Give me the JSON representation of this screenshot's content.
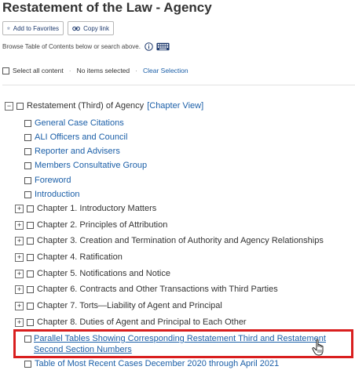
{
  "page_title": "Restatement of the Law - Agency",
  "toolbar": {
    "add_favorites": "Add to Favorites",
    "copy_link": "Copy link"
  },
  "browse_hint": "Browse Table of Contents below or search above.",
  "selection": {
    "select_all": "Select all content",
    "status": "No items selected",
    "clear": "Clear Selection"
  },
  "toc": {
    "root": {
      "label": "Restatement (Third) of Agency",
      "chapter_view": "[Chapter View]"
    },
    "links": [
      "General Case Citations",
      "ALI Officers and Council",
      "Reporter and Advisers",
      "Members Consultative Group",
      "Foreword",
      "Introduction"
    ],
    "chapters": [
      "Chapter 1. Introductory Matters",
      "Chapter 2. Principles of Attribution",
      "Chapter 3. Creation and Termination of Authority and Agency Relationships",
      "Chapter 4. Ratification",
      "Chapter 5. Notifications and Notice",
      "Chapter 6. Contracts and Other Transactions with Third Parties",
      "Chapter 7. Torts—Liability of Agent and Principal",
      "Chapter 8. Duties of Agent and Principal to Each Other"
    ],
    "highlighted": "Parallel Tables Showing Corresponding Restatement Third and Restatement Second Section Numbers",
    "last": "Table of Most Recent Cases December 2020 through April 2021"
  },
  "colors": {
    "link": "#1b5fa8",
    "highlight_border": "#d91f1f"
  }
}
